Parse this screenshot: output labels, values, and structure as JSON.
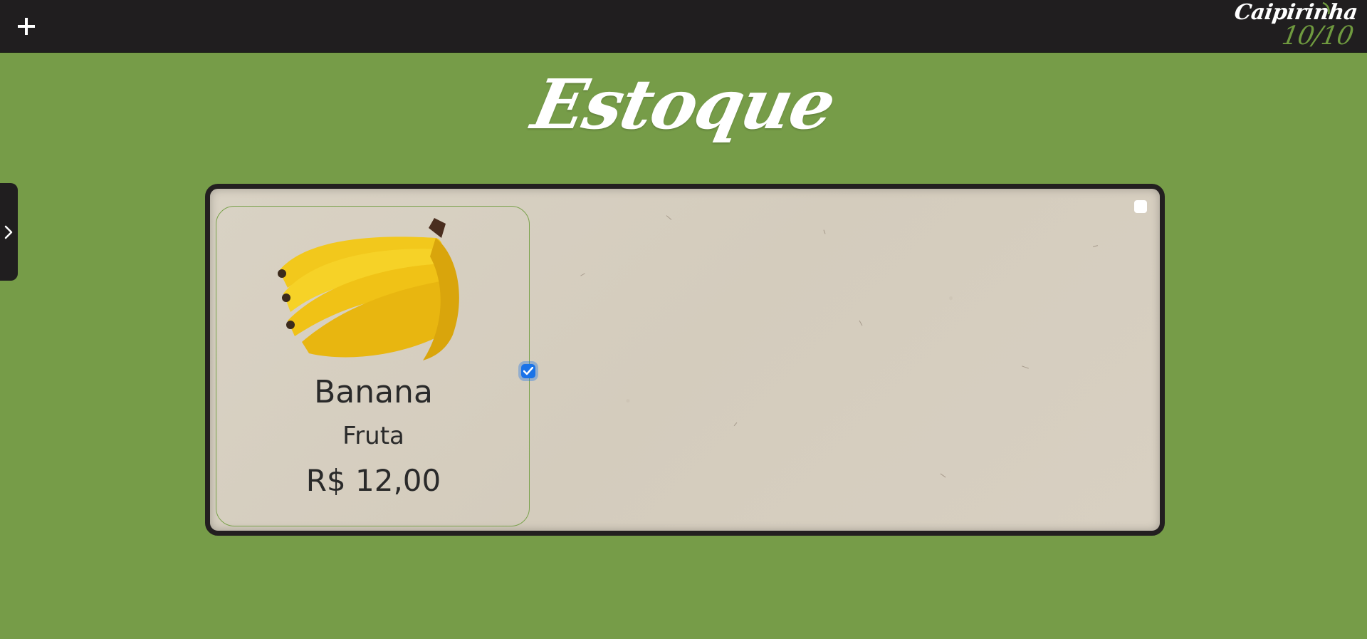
{
  "header": {
    "add_icon": "plus-icon",
    "brand_top": "Caipirinha",
    "brand_bottom": "10/10",
    "colors": {
      "bar": "#201e1f",
      "brand_accent": "#6f9a3f"
    }
  },
  "page": {
    "title": "Estoque",
    "background": "#769c48"
  },
  "sidebar": {
    "toggle_icon": "chevron-right-icon"
  },
  "panel": {
    "select_all_checked": false,
    "items": [
      {
        "name": "Banana",
        "category": "Fruta",
        "price": "R$ 12,00",
        "image": "banana-bunch",
        "checked": true
      }
    ]
  }
}
